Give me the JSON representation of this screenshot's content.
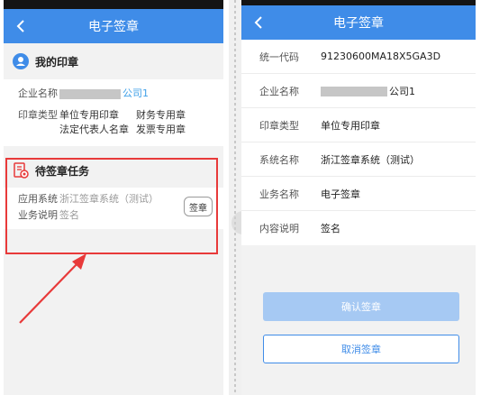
{
  "left": {
    "title": "电子签章",
    "my_seals": {
      "heading": "我的印章",
      "company_label": "企业名称",
      "company_suffix": "公司1",
      "seal_type_label": "印章类型",
      "seal_types": [
        "单位专用印章",
        "财务专用章",
        "法定代表人名章",
        "发票专用章"
      ]
    },
    "pending": {
      "heading": "待签章任务",
      "app_label": "应用系统",
      "app_value": "浙江签章系统（测试）",
      "biz_label": "业务说明",
      "biz_value": "签名",
      "sign_button": "签章"
    }
  },
  "toast_text": "",
  "right": {
    "title": "电子签章",
    "rows": [
      {
        "label": "统一代码",
        "value": "91230600MA18X5GA3D"
      },
      {
        "label": "企业名称",
        "value": "公司1",
        "redacted": true
      },
      {
        "label": "印章类型",
        "value": "单位专用印章"
      },
      {
        "label": "系统名称",
        "value": "浙江签章系统（测试）"
      },
      {
        "label": "业务名称",
        "value": "电子签章"
      },
      {
        "label": "内容说明",
        "value": "签名"
      }
    ],
    "confirm_button": "确认签章",
    "cancel_button": "取消签章"
  },
  "colors": {
    "brand_blue": "#3f8ce8",
    "annotation_red": "#e83a3a",
    "confirm_disabled": "#a6c9f3"
  }
}
